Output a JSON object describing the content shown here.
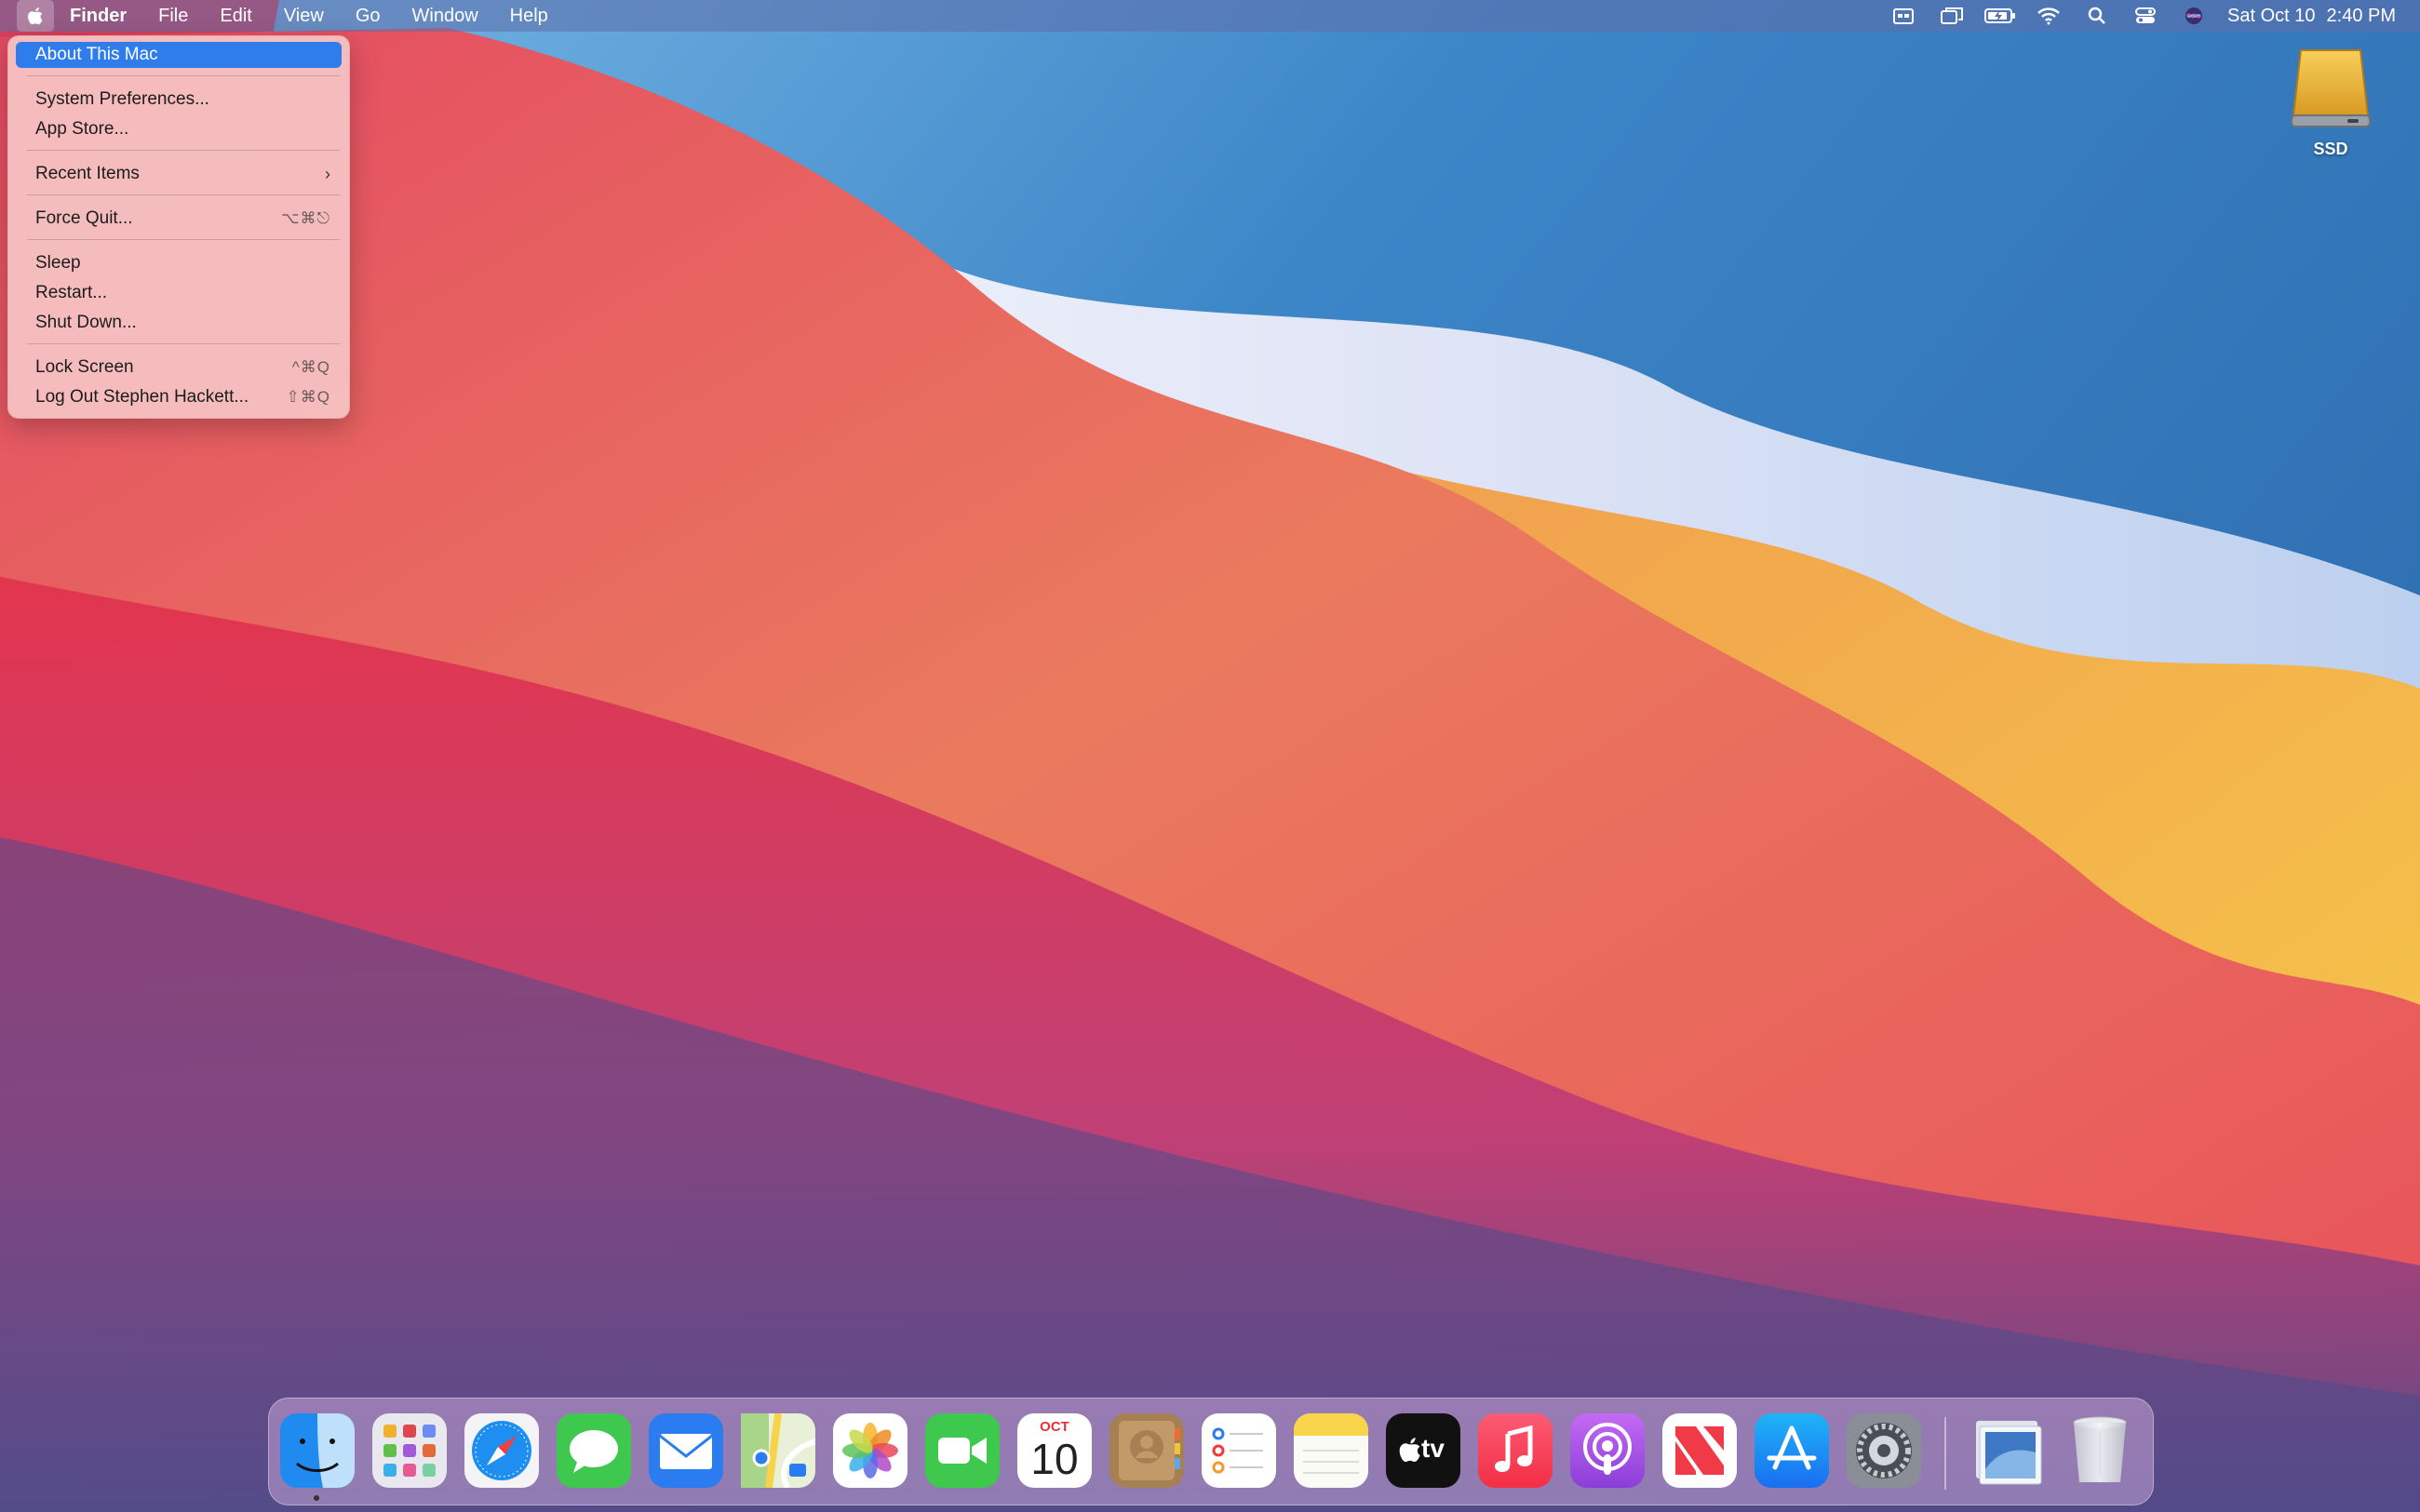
{
  "menubar": {
    "items": [
      "Finder",
      "File",
      "Edit",
      "View",
      "Go",
      "Window",
      "Help"
    ],
    "status_icons": [
      "calendar-widget-icon",
      "screen-mirroring-icon",
      "battery-icon",
      "wifi-icon",
      "search-icon",
      "control-center-icon",
      "siri-icon"
    ],
    "date": "Sat Oct 10",
    "time": "2:40 PM"
  },
  "apple_menu": {
    "items": [
      {
        "label": "About This Mac",
        "shortcut": "",
        "selected": true
      },
      {
        "label": "System Preferences...",
        "shortcut": ""
      },
      {
        "label": "App Store...",
        "shortcut": ""
      },
      {
        "label": "Recent Items",
        "shortcut": ""
      },
      {
        "label": "Force Quit...",
        "shortcut": "⌥⌘⎋"
      },
      {
        "label": "Sleep",
        "shortcut": ""
      },
      {
        "label": "Restart...",
        "shortcut": ""
      },
      {
        "label": "Shut Down...",
        "shortcut": ""
      },
      {
        "label": "Lock Screen",
        "shortcut": "^⌘Q"
      },
      {
        "label": "Log Out Stephen Hackett...",
        "shortcut": "⇧⌘Q"
      }
    ]
  },
  "desktop": {
    "drive_label": "SSD"
  },
  "dock": {
    "apps": [
      "finder-icon",
      "launchpad-icon",
      "safari-icon",
      "messages-icon",
      "mail-icon",
      "maps-icon",
      "photos-icon",
      "facetime-icon",
      "calendar-icon",
      "contacts-icon",
      "reminders-icon",
      "notes-icon",
      "apple-tv-icon",
      "music-icon",
      "podcasts-icon",
      "news-icon",
      "app-store-icon",
      "system-preferences-icon",
      "downloads-stack-icon",
      "trash-icon"
    ],
    "calendar_month": "OCT",
    "calendar_day": "10",
    "tv_label": "tv"
  },
  "colors": {
    "menu_highlight": "#2f7dec",
    "wallpaper_red": "#e8364e",
    "wallpaper_blue": "#3a7cc0",
    "wallpaper_orange": "#f0a24a"
  }
}
